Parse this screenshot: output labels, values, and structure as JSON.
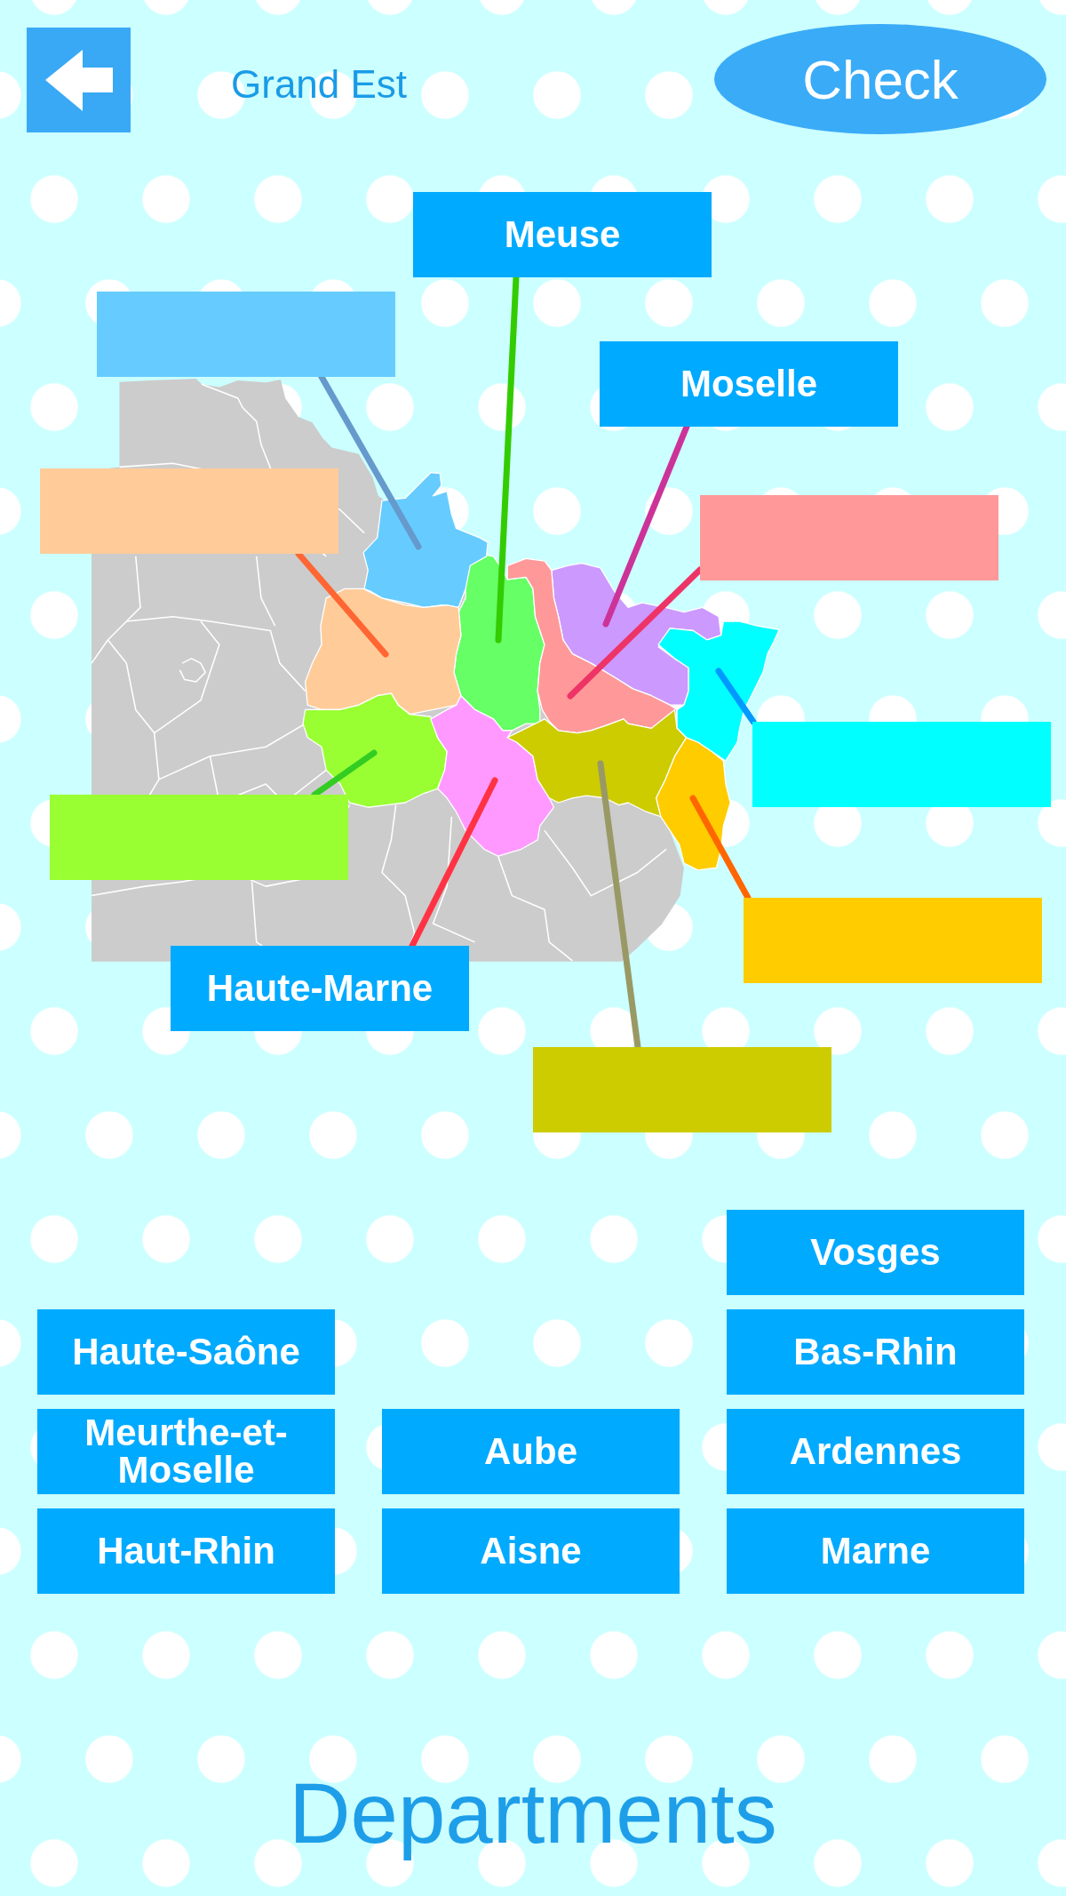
{
  "header": {
    "title": "Grand Est",
    "check_label": "Check"
  },
  "map": {
    "regions": [
      {
        "answered": true,
        "label": "Meuse",
        "color": "#66ff66",
        "leader": {
          "color": "#33cc00"
        }
      },
      {
        "answered": false,
        "color": "#66ccff",
        "leader": {
          "color": "#6699cc"
        }
      },
      {
        "answered": true,
        "label": "Moselle",
        "color": "#cc99ff",
        "leader": {
          "color": "#cc3399"
        }
      },
      {
        "answered": false,
        "color": "#ffcc99",
        "leader": {
          "color": "#ff6633"
        }
      },
      {
        "answered": false,
        "color": "#ff9999",
        "leader": {
          "color": "#ee3366"
        }
      },
      {
        "answered": false,
        "color": "#00ffff",
        "leader": {
          "color": "#0099ff"
        }
      },
      {
        "answered": false,
        "color": "#99ff33",
        "leader": {
          "color": "#33cc22"
        }
      },
      {
        "answered": false,
        "color": "#ffcc00",
        "leader": {
          "color": "#ff6600"
        }
      },
      {
        "answered": true,
        "label": "Haute-Marne",
        "color": "#ff99ff",
        "leader": {
          "color": "#ff3344"
        }
      },
      {
        "answered": false,
        "color": "#cccc00",
        "leader": {
          "color": "#999966"
        }
      }
    ]
  },
  "tile_columns": [
    [
      {
        "label": "Haute-Saône"
      },
      {
        "label": "Meurthe-et-Moselle"
      },
      {
        "label": "Haut-Rhin"
      }
    ],
    [
      {
        "label": "Aube"
      },
      {
        "label": "Aisne"
      }
    ],
    [
      {
        "label": "Vosges"
      },
      {
        "label": "Bas-Rhin"
      },
      {
        "label": "Ardennes"
      },
      {
        "label": "Marne"
      }
    ]
  ],
  "footer": {
    "title": "Departments"
  }
}
